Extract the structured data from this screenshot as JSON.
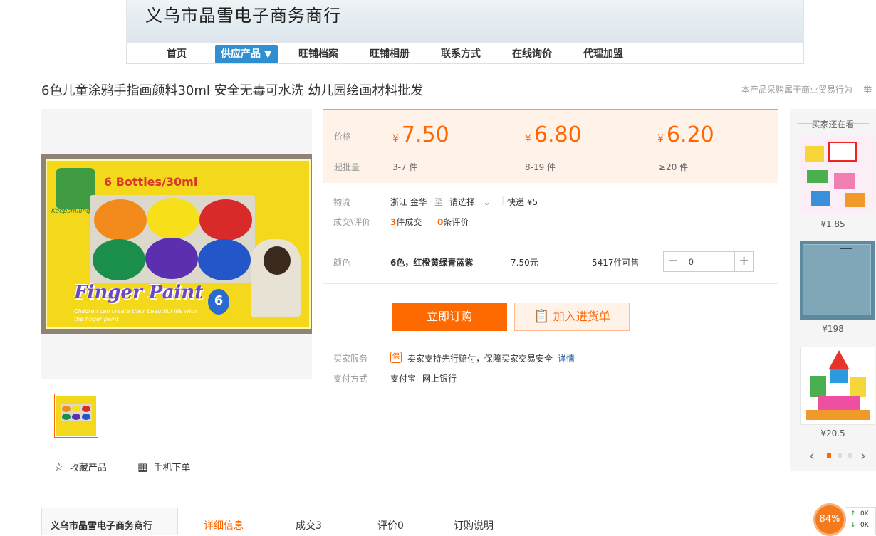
{
  "shop": {
    "name": "义乌市晶雪电子商务商行"
  },
  "nav": {
    "items": [
      "首页",
      "供应产品 ▼",
      "旺铺档案",
      "旺铺相册",
      "联系方式",
      "在线询价",
      "代理加盟"
    ]
  },
  "product": {
    "title": "6色儿童涂鸦手指画颜料30ml 安全无毒可水洗 幼儿园绘画材料批发",
    "trade_note": "本产品采购属于商业贸易行为",
    "report": "举",
    "image_text": {
      "bottles": "6 Bottles/30ml",
      "brand": "Keepsmiling",
      "name": "Finger Paint",
      "colors": "6",
      "tagline": "Children can create their beautiful life with the finger paint"
    }
  },
  "pricing": {
    "price_label": "价格",
    "moq_label": "起批量",
    "currency": "¥",
    "tiers": [
      {
        "price": "7.50",
        "range": "3-7 件"
      },
      {
        "price": "6.80",
        "range": "8-19 件"
      },
      {
        "price": "6.20",
        "range": "≥20 件"
      }
    ]
  },
  "logistics": {
    "label": "物流",
    "origin": "浙江 金华",
    "to": "至",
    "destination": "请选择",
    "express": "快递",
    "fee": "¥5"
  },
  "stats": {
    "label": "成交\\评价",
    "deals_num": "3",
    "deals_text": "件成交",
    "reviews_num": "0",
    "reviews_text": "条评价"
  },
  "sku": {
    "label": "颜色",
    "name": "6色，红橙黄绿青蓝紫",
    "price": "7.50元",
    "stock": "5417件可售",
    "quantity": "0"
  },
  "actions": {
    "buy": "立即订购",
    "cart": "加入进货单"
  },
  "service": {
    "label": "买家服务",
    "badge": "保",
    "text": "卖家支持先行赔付，保障买家交易安全",
    "link": "详情"
  },
  "payment": {
    "label": "支付方式",
    "methods": [
      "支付宝",
      "网上银行"
    ]
  },
  "links": {
    "favorite": "收藏产品",
    "mobile": "手机下单"
  },
  "sidebar": {
    "title": "买家还在看",
    "items": [
      {
        "price": "¥1.85"
      },
      {
        "price": "¥198"
      },
      {
        "price": "¥20.5"
      }
    ]
  },
  "bottom": {
    "shop_name": "义乌市晶雪电子商务商行",
    "tabs": [
      "详细信息",
      "成交3",
      "评价0",
      "订购说明"
    ]
  },
  "widget": {
    "percent": "84%",
    "up": "0K",
    "down": "0K"
  },
  "colors": {
    "accent": "#ff6a00",
    "nav_active": "#2f8fd0",
    "price_bg": "#fff2e9"
  }
}
